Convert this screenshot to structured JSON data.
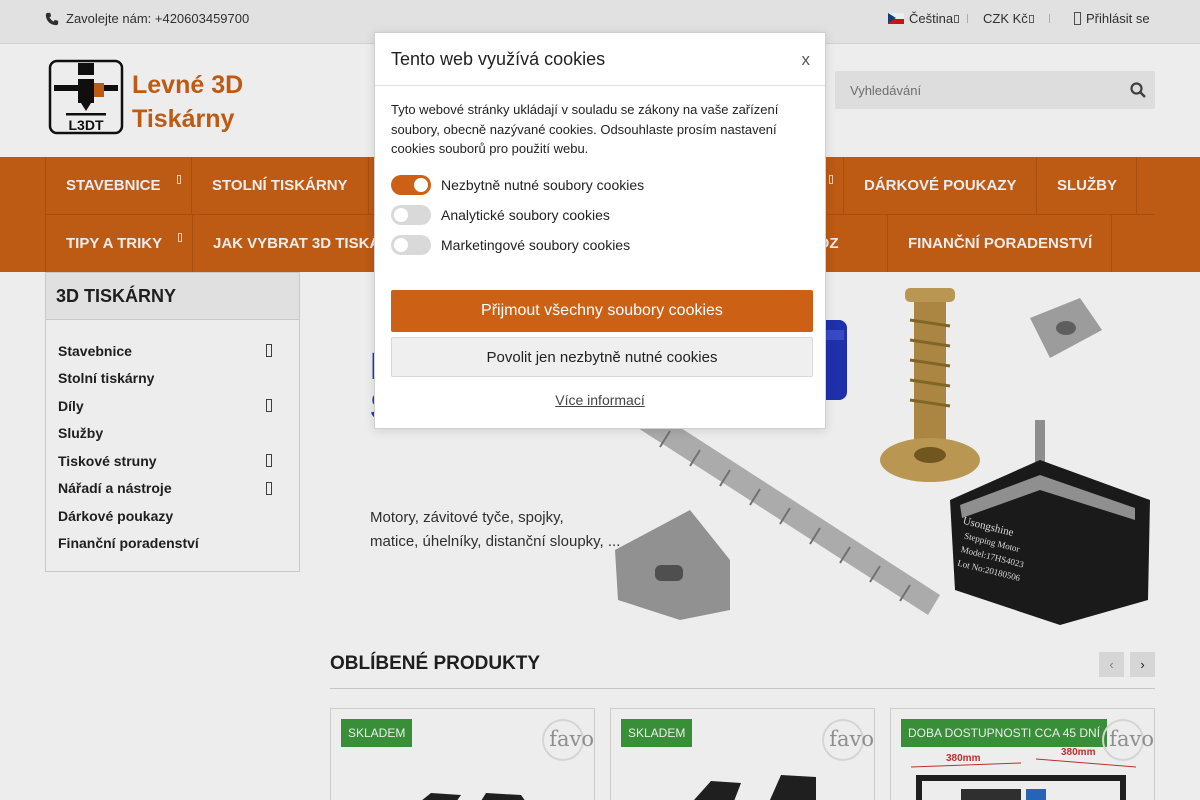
{
  "topbar": {
    "phone_label": "Zavolejte nám: +420603459700",
    "language": "Čeština",
    "currency": "CZK Kč",
    "login": "Přihlásit se"
  },
  "header": {
    "logo_line1": "Levné 3D",
    "logo_line2": "Tiskárny",
    "logo_badge": "L3DT",
    "search_placeholder": "Vyhledávání"
  },
  "nav": {
    "row1": [
      "STAVEBNICE",
      "STOLNÍ TISKÁRNY",
      "",
      "",
      "DÁRKOVÉ POUKAZY",
      "SLUŽBY"
    ],
    "row2": [
      "TIPY A TRIKY",
      "JAK VYBRAT 3D TISKÁ",
      "",
      "OVOZ",
      "FINANČNÍ PORADENSTVÍ"
    ]
  },
  "sidebar": {
    "title": "3D TISKÁRNY",
    "items": [
      {
        "label": "Stavebnice",
        "expandable": true
      },
      {
        "label": "Stolní tiskárny",
        "expandable": false
      },
      {
        "label": "Díly",
        "expandable": true
      },
      {
        "label": "Služby",
        "expandable": false
      },
      {
        "label": "Tiskové struny",
        "expandable": true
      },
      {
        "label": "Nářadí a nástroje",
        "expandable": true
      },
      {
        "label": "Dárkové poukazy",
        "expandable": false
      },
      {
        "label": "Finanční poradenství",
        "expandable": false
      }
    ]
  },
  "banner": {
    "text_line1": "Motory, závitové tyče, spojky,",
    "text_line2": "matice, úhelníky, distanční sloupky, ...",
    "motor_label1": "Usongshine",
    "motor_label2": "Stepping Motor",
    "motor_label3": "Model:17HS4023",
    "motor_label4": "Lot No:20180506"
  },
  "products": {
    "title": "OBLÍBENÉ PRODUKTY",
    "prev_icon": "‹",
    "next_icon": "›",
    "cards": [
      {
        "badge": "SKLADEM",
        "badge_color": "#3d9a3d",
        "favo": "favo"
      },
      {
        "badge": "SKLADEM",
        "badge_color": "#3d9a3d",
        "favo": "favo"
      },
      {
        "badge": "DOBA DOSTUPNOSTI CCA 45 DNÍ",
        "badge_color": "#3d9a3d",
        "favo": "favo",
        "dim1": "380mm",
        "dim2": "380mm"
      }
    ]
  },
  "cookie": {
    "title": "Tento web využívá cookies",
    "close": "x",
    "text": "Tyto webové stránky ukládají v souladu se zákony na vaše zařízení soubory, obecně nazývané cookies. Odsouhlaste prosím nastavení cookies souborů pro použití webu.",
    "toggles": [
      {
        "label": "Nezbytně nutné soubory cookies",
        "on": true
      },
      {
        "label": "Analytické soubory cookies",
        "on": false
      },
      {
        "label": "Marketingové soubory cookies",
        "on": false
      }
    ],
    "accept_all": "Přijmout všechny soubory cookies",
    "necessary_only": "Povolit jen nezbytně nutné cookies",
    "more_info": "Více informací"
  },
  "colors": {
    "brand_orange": "#cc6116",
    "stock_green": "#3d9a3d"
  }
}
